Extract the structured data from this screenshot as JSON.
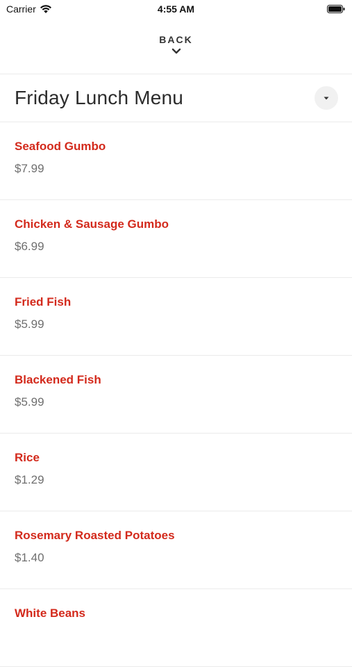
{
  "status_bar": {
    "carrier": "Carrier",
    "time": "4:55 AM"
  },
  "nav": {
    "back_label": "BACK"
  },
  "header": {
    "title": "Friday Lunch Menu"
  },
  "menu": {
    "items": [
      {
        "name": "Seafood Gumbo",
        "price": "$7.99"
      },
      {
        "name": "Chicken & Sausage Gumbo",
        "price": "$6.99"
      },
      {
        "name": "Fried Fish",
        "price": "$5.99"
      },
      {
        "name": "Blackened Fish",
        "price": "$5.99"
      },
      {
        "name": "Rice",
        "price": "$1.29"
      },
      {
        "name": "Rosemary Roasted Potatoes",
        "price": "$1.40"
      },
      {
        "name": "White Beans",
        "price": ""
      }
    ]
  },
  "colors": {
    "item_name": "#d32a1c",
    "item_price": "#6f6f6f",
    "title": "#2c2c2c",
    "divider": "#ebebeb"
  },
  "icons": {
    "wifi": "wifi-icon",
    "battery": "battery-icon",
    "back": "chevron-down-icon",
    "dropdown": "caret-down-icon"
  }
}
